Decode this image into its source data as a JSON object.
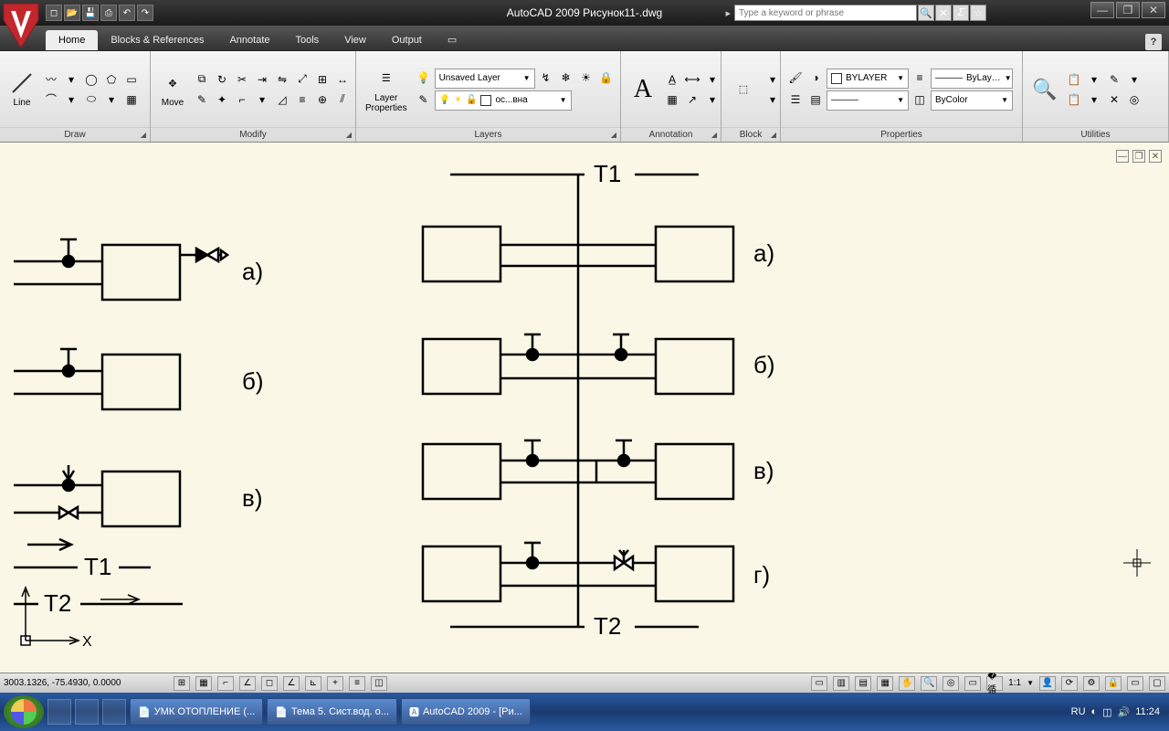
{
  "title": "AutoCAD 2009 Рисунок11-.dwg",
  "search_placeholder": "Type a keyword or phrase",
  "tabs": [
    "Home",
    "Blocks & References",
    "Annotate",
    "Tools",
    "View",
    "Output"
  ],
  "ribbon": {
    "draw": "Draw",
    "modify": "Modify",
    "layers": "Layers",
    "annotation": "Annotation",
    "block": "Block",
    "properties": "Properties",
    "utilities": "Utilities",
    "line": "Line",
    "move": "Move",
    "layer_properties": "Layer\nProperties",
    "unsaved_layer": "Unsaved Layer",
    "layer_current": "ос...вна",
    "bylayer": "BYLAYER",
    "bylay2": "ByLay…",
    "bycolor": "ByColor"
  },
  "drawing": {
    "labels": {
      "a": "а)",
      "b": "б)",
      "v": "в)",
      "g": "г)",
      "t1": "T1",
      "t2": "T2",
      "x": "X"
    }
  },
  "status": {
    "coords": "3003.1326, -75.4930, 0.0000",
    "scale": "1:1"
  },
  "taskbar": {
    "items": [
      "УМК ОТОПЛЕНИЕ (...",
      "Тема 5. Сист.вод. о...",
      "AutoCAD 2009 - [Ри..."
    ],
    "lang": "RU",
    "time": "11:24"
  }
}
